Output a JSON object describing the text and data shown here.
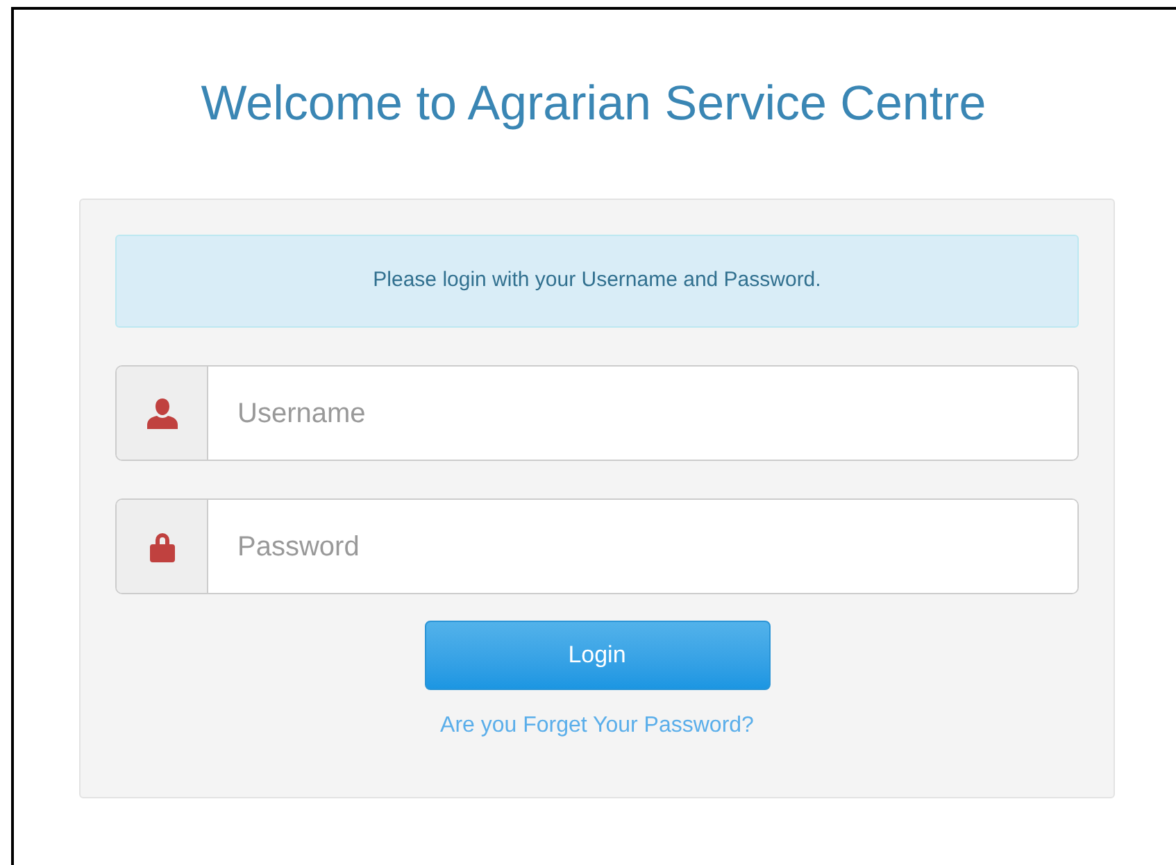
{
  "title": "Welcome to Agrarian Service Centre",
  "alert": "Please login with your Username and Password.",
  "fields": [
    {
      "kind": "user",
      "placeholder": "Username"
    },
    {
      "kind": "lock",
      "placeholder": "Password"
    }
  ],
  "login_button": "Login",
  "forgot_link": "Are you Forget Your Password?"
}
